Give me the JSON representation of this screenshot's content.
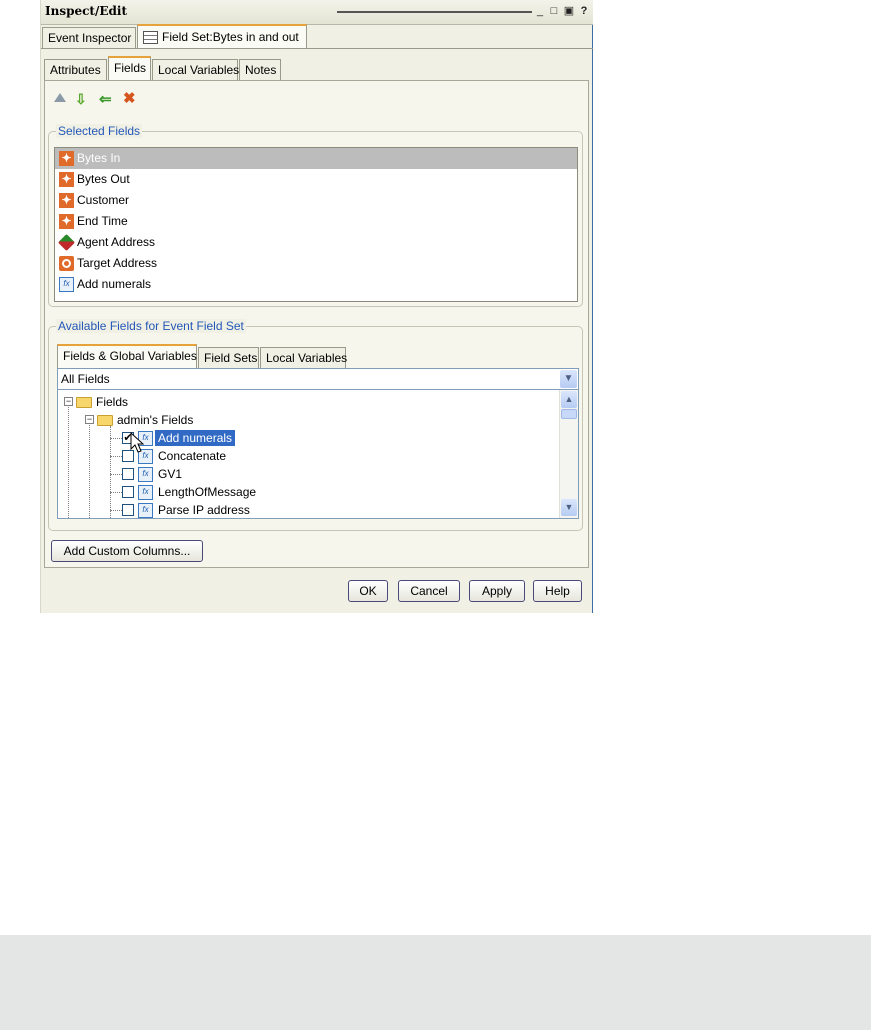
{
  "window": {
    "title": "Inspect/Edit",
    "controls": [
      "_",
      "□",
      "▣",
      "?"
    ]
  },
  "main_tabs": [
    {
      "label": "Event Inspector",
      "active": false
    },
    {
      "label": "Field Set:Bytes in and out",
      "active": true
    }
  ],
  "sub_tabs": [
    {
      "label": "Attributes",
      "active": false
    },
    {
      "label": "Fields",
      "active": true
    },
    {
      "label": "Local Variables",
      "active": false
    },
    {
      "label": "Notes",
      "active": false
    }
  ],
  "toolbar": {
    "icons": [
      "move-up-icon",
      "move-down-icon",
      "add-icon",
      "remove-icon"
    ]
  },
  "selected_fields": {
    "legend": "Selected Fields",
    "items": [
      {
        "label": "Bytes In",
        "icon": "field-icon",
        "selected": true
      },
      {
        "label": "Bytes Out",
        "icon": "field-icon"
      },
      {
        "label": "Customer",
        "icon": "field-icon"
      },
      {
        "label": "End Time",
        "icon": "field-icon"
      },
      {
        "label": "Agent Address",
        "icon": "address-icon"
      },
      {
        "label": "Target Address",
        "icon": "target-icon"
      },
      {
        "label": "Add numerals",
        "icon": "variable-icon"
      }
    ]
  },
  "available_fields": {
    "legend": "Available Fields for Event Field Set",
    "tabs": [
      {
        "label": "Fields & Global Variables",
        "active": true
      },
      {
        "label": "Field Sets",
        "active": false
      },
      {
        "label": "Local Variables",
        "active": false
      }
    ],
    "filter_value": "All Fields",
    "tree": {
      "root": "Fields",
      "folder": "admin's Fields",
      "items": [
        {
          "label": "Add numerals",
          "checked": true,
          "highlighted": true
        },
        {
          "label": "Concatenate",
          "checked": false
        },
        {
          "label": "GV1",
          "checked": false
        },
        {
          "label": "LengthOfMessage",
          "checked": false
        },
        {
          "label": "Parse IP address",
          "checked": false
        }
      ]
    }
  },
  "buttons": {
    "add_custom_columns": "Add Custom Columns...",
    "ok": "OK",
    "cancel": "Cancel",
    "apply": "Apply",
    "help": "Help"
  },
  "colors": {
    "accent_tab": "#e8a23c",
    "legend_text": "#2457b8",
    "field_icon": "#e06a2a",
    "highlight": "#316ac5"
  }
}
